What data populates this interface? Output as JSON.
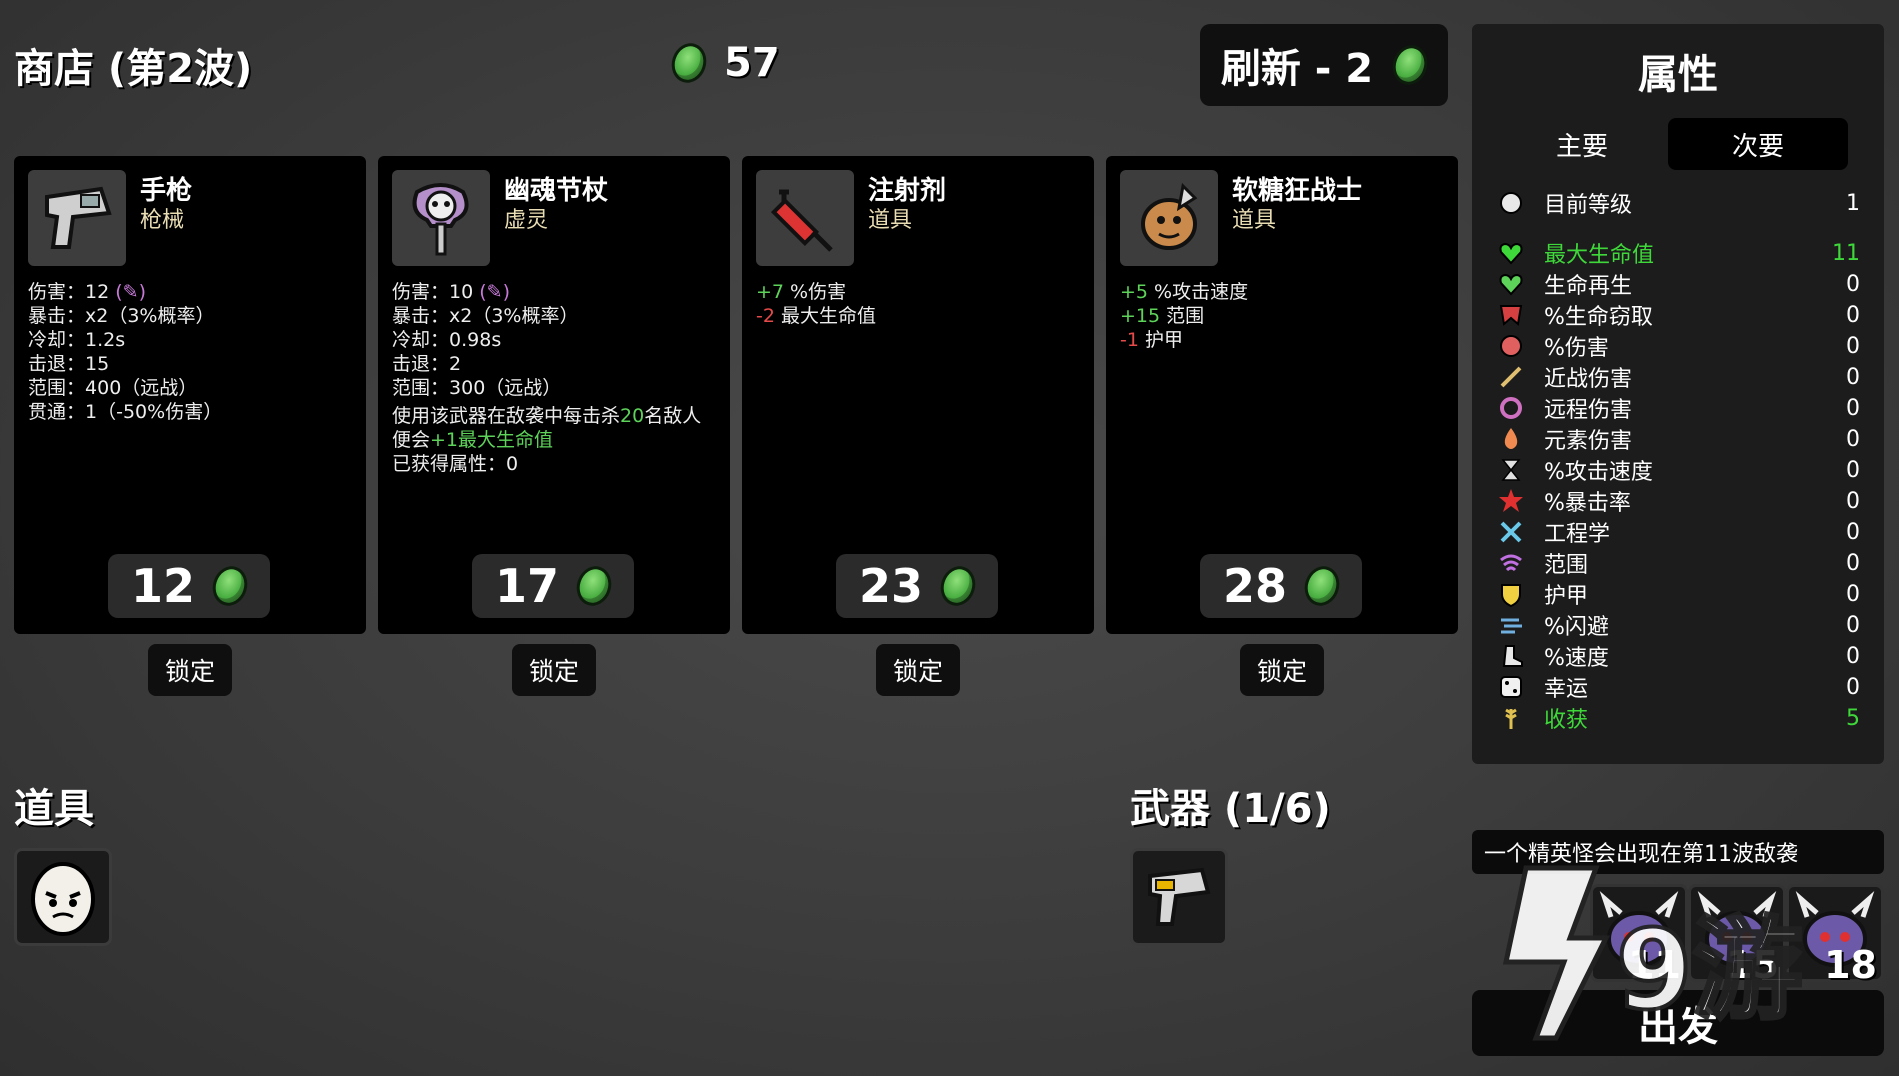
{
  "header": {
    "shop_title": "商店 (第2波)",
    "materials": "57",
    "refresh_label": "刷新 - 2"
  },
  "cards": [
    {
      "name": "手枪",
      "type": "枪械",
      "icon": "pistol-icon",
      "price": "12",
      "lock_label": "锁定",
      "stats": [
        {
          "label": "伤害：",
          "value": "12"
        },
        {
          "label": "暴击：",
          "value": "x2（3%概率）"
        },
        {
          "label": "冷却：",
          "value": "1.2s"
        },
        {
          "label": "击退：",
          "value": "15"
        },
        {
          "label": "范围：",
          "value": "400（远战）"
        },
        {
          "label": "贯通：",
          "value": "1（-50%伤害）"
        }
      ]
    },
    {
      "name": "幽魂节杖",
      "type": "虚灵",
      "icon": "ghost-scepter-icon",
      "price": "17",
      "lock_label": "锁定",
      "stats": [
        {
          "label": "伤害：",
          "value": "10"
        },
        {
          "label": "暴击：",
          "value": "x2（3%概率）"
        },
        {
          "label": "冷却：",
          "value": "0.98s"
        },
        {
          "label": "击退：",
          "value": "2"
        },
        {
          "label": "范围：",
          "value": "300（远战）"
        }
      ],
      "effect": {
        "pre": "使用该武器在敌袭中每击杀",
        "num": "20",
        "mid": "名敌人便会",
        "bonus": "+1最大生命值"
      },
      "obtained": "已获得属性：0"
    },
    {
      "name": "注射剂",
      "type": "道具",
      "icon": "syringe-icon",
      "price": "23",
      "lock_label": "锁定",
      "mods": [
        {
          "sign": "+7",
          "text": " %伤害",
          "positive": true
        },
        {
          "sign": "-2",
          "text": " 最大生命值",
          "positive": false
        }
      ]
    },
    {
      "name": "软糖狂战士",
      "type": "道具",
      "icon": "gummy-berserker-icon",
      "price": "28",
      "lock_label": "锁定",
      "mods": [
        {
          "sign": "+5",
          "text": " %攻击速度",
          "positive": true
        },
        {
          "sign": "+15",
          "text": " 范围",
          "positive": true
        },
        {
          "sign": "-1",
          "text": " 护甲",
          "positive": false
        }
      ]
    }
  ],
  "items_section": {
    "title": "道具",
    "items": [
      "potato-character-icon"
    ]
  },
  "weapons_section": {
    "title": "武器 (1/6)",
    "weapons": [
      "pistol-icon"
    ]
  },
  "stats_panel": {
    "title": "属性",
    "tabs": [
      {
        "label": "主要",
        "active": false
      },
      {
        "label": "次要",
        "active": true
      }
    ],
    "level": {
      "icon": "level-icon",
      "label": "目前等级",
      "value": "1"
    },
    "rows": [
      {
        "icon": "heart-icon",
        "label": "最大生命值",
        "value": "11",
        "highlight": true
      },
      {
        "icon": "heart-regen-icon",
        "label": "生命再生",
        "value": "0"
      },
      {
        "icon": "lifesteal-icon",
        "label": "%生命窃取",
        "value": "0"
      },
      {
        "icon": "damage-fist-icon",
        "label": "%伤害",
        "value": "0"
      },
      {
        "icon": "melee-sword-icon",
        "label": "近战伤害",
        "value": "0"
      },
      {
        "icon": "ranged-bow-icon",
        "label": "远程伤害",
        "value": "0"
      },
      {
        "icon": "elemental-flame-icon",
        "label": "元素伤害",
        "value": "0"
      },
      {
        "icon": "hourglass-icon",
        "label": "%攻击速度",
        "value": "0"
      },
      {
        "icon": "crit-burst-icon",
        "label": "%暴击率",
        "value": "0"
      },
      {
        "icon": "engineering-wrench-icon",
        "label": "工程学",
        "value": "0"
      },
      {
        "icon": "range-signal-icon",
        "label": "范围",
        "value": "0"
      },
      {
        "icon": "armor-shield-icon",
        "label": "护甲",
        "value": "0"
      },
      {
        "icon": "dodge-wind-icon",
        "label": "%闪避",
        "value": "0"
      },
      {
        "icon": "speed-boot-icon",
        "label": "%速度",
        "value": "0"
      },
      {
        "icon": "luck-dice-icon",
        "label": "幸运",
        "value": "0"
      },
      {
        "icon": "harvest-wheat-icon",
        "label": "收获",
        "value": "5",
        "highlight": true
      }
    ]
  },
  "elite_notice": "一个精英怪会出现在第11波敌袭",
  "elite_waves": [
    "11",
    "15",
    "18"
  ],
  "go_label": "出发",
  "watermark": "9游",
  "colors": {
    "material_green": "#4bb043",
    "positive": "#5ed35a",
    "negative": "#e64a4a",
    "highlight_stat": "#3fd83a"
  }
}
